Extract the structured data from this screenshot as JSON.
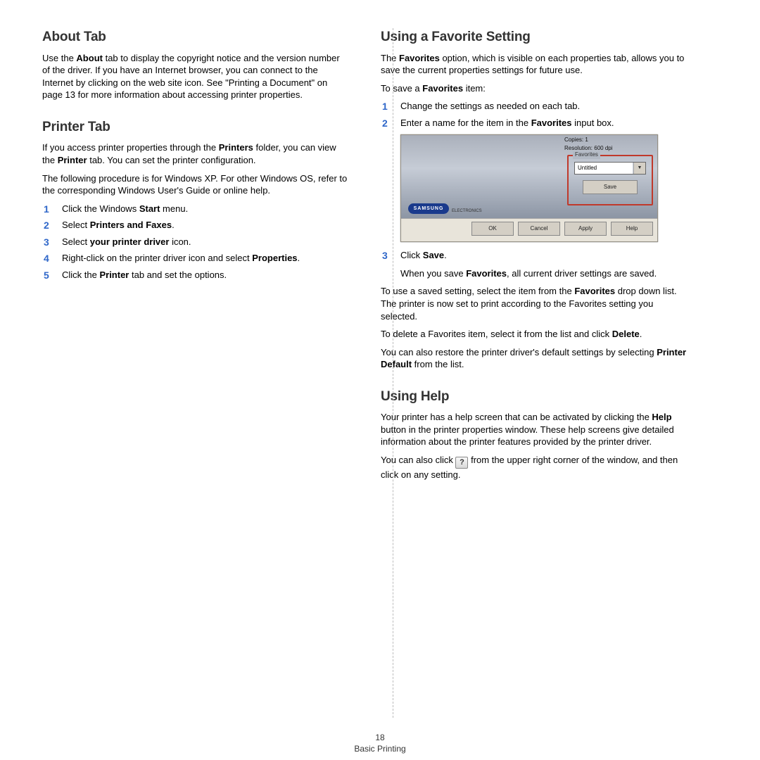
{
  "left": {
    "h1": "About Tab",
    "p1a": "Use the ",
    "p1b": "About",
    "p1c": " tab to display the copyright notice and the version number of the driver. If you have an Internet browser, you can connect to the Internet by clicking on the web site icon. See \"Printing a Document\" on page 13 for more information about accessing printer properties.",
    "h2": "Printer Tab",
    "p2a": "If you access printer properties through the ",
    "p2b": "Printers",
    "p2c": " folder, you can view the ",
    "p2d": "Printer",
    "p2e": " tab. You can set the printer configuration.",
    "p3": "The following procedure is for Windows XP. For other Windows OS, refer to the corresponding Windows User's Guide or online help.",
    "steps": [
      {
        "n": "1",
        "a": "Click the Windows ",
        "b": "Start",
        "c": " menu."
      },
      {
        "n": "2",
        "a": "Select ",
        "b": "Printers and Faxes",
        "c": "."
      },
      {
        "n": "3",
        "a": "Select ",
        "b": "your printer driver",
        "c": " icon."
      },
      {
        "n": "4",
        "a": "Right-click on the printer driver icon and select ",
        "b": "Properties",
        "c": "."
      },
      {
        "n": "5",
        "a": "Click the ",
        "b": "Printer",
        "c": " tab and set the options."
      }
    ]
  },
  "right": {
    "h1": "Using a Favorite Setting",
    "p1a": "The ",
    "p1b": "Favorites",
    "p1c": " option, which is visible on each properties tab, allows you to save the current properties settings for future use.",
    "p2a": "To save a ",
    "p2b": "Favorites",
    "p2c": " item:",
    "steps1": [
      {
        "n": "1",
        "a": "Change the settings as needed on each tab.",
        "b": "",
        "c": ""
      },
      {
        "n": "2",
        "a": "Enter a name for the item in the ",
        "b": "Favorites",
        "c": " input box."
      }
    ],
    "dlg": {
      "copies": "Copies: 1",
      "res": "Resolution: 600 dpi",
      "fav_legend": "Favorites",
      "fav_value": "Untitled",
      "save": "Save",
      "logo": "SAMSUNG",
      "logo_sub": "ELECTRONICS",
      "btns": [
        "OK",
        "Cancel",
        "Apply",
        "Help"
      ]
    },
    "step3n": "3",
    "step3a": "Click ",
    "step3b": "Save",
    "step3c": ".",
    "sub3a": "When you save ",
    "sub3b": "Favorites",
    "sub3c": ", all current driver settings are saved.",
    "p3a": "To use a saved setting, select the item from the ",
    "p3b": "Favorites",
    "p3c": " drop down list. The printer is now set to print according to the Favorites setting you selected.",
    "p4a": "To delete a Favorites item, select it from the list and click ",
    "p4b": "Delete",
    "p4c": ".",
    "p5a": "You can also restore the printer driver's default settings by selecting ",
    "p5b": "Printer Default",
    "p5c": " from the list.",
    "h2": "Using Help",
    "p6a": "Your printer has a help screen that can be activated by clicking the ",
    "p6b": "Help",
    "p6c": " button in the printer properties window. These help screens give detailed information about the printer features provided by the printer driver.",
    "p7a": "You can also click ",
    "p7c": " from the upper right corner of the window, and then click on any setting.",
    "help_glyph": "?"
  },
  "footer": {
    "page": "18",
    "section": "Basic Printing"
  }
}
